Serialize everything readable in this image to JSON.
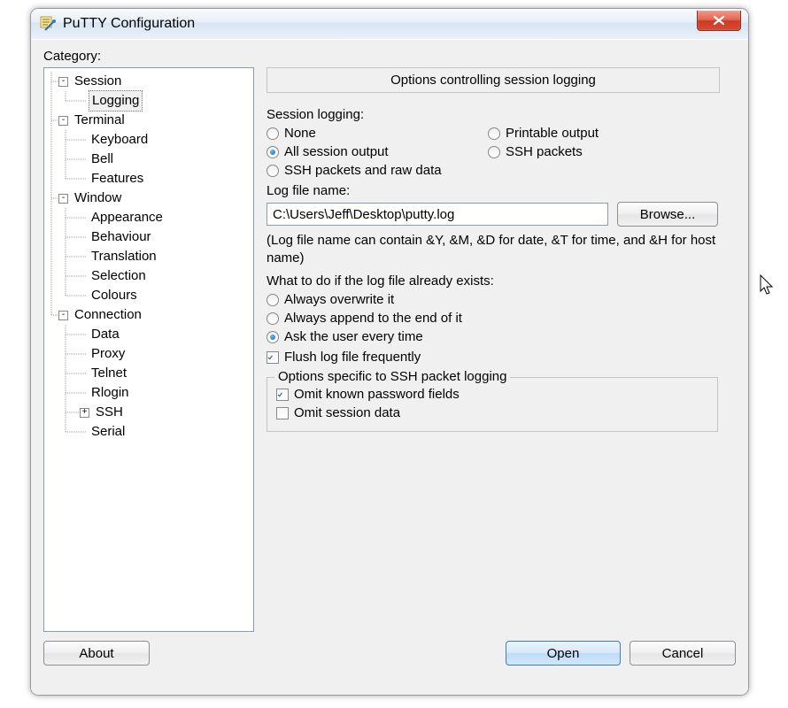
{
  "window": {
    "title": "PuTTY Configuration",
    "close_label": "X"
  },
  "sidebar": {
    "category_label": "Category:",
    "selected": "Logging",
    "tree": [
      {
        "label": "Session",
        "expand": "-",
        "children": [
          {
            "label": "Logging"
          }
        ]
      },
      {
        "label": "Terminal",
        "expand": "-",
        "children": [
          {
            "label": "Keyboard"
          },
          {
            "label": "Bell"
          },
          {
            "label": "Features"
          }
        ]
      },
      {
        "label": "Window",
        "expand": "-",
        "children": [
          {
            "label": "Appearance"
          },
          {
            "label": "Behaviour"
          },
          {
            "label": "Translation"
          },
          {
            "label": "Selection"
          },
          {
            "label": "Colours"
          }
        ]
      },
      {
        "label": "Connection",
        "expand": "-",
        "children": [
          {
            "label": "Data"
          },
          {
            "label": "Proxy"
          },
          {
            "label": "Telnet"
          },
          {
            "label": "Rlogin"
          },
          {
            "label": "SSH",
            "expand": "+"
          },
          {
            "label": "Serial"
          }
        ]
      }
    ]
  },
  "panel": {
    "heading": "Options controlling session logging",
    "session_logging_label": "Session logging:",
    "radios_logging": {
      "none": "None",
      "printable": "Printable output",
      "all": "All session output",
      "ssh": "SSH packets",
      "raw": "SSH packets and raw data",
      "selected": "all"
    },
    "logfile_label": "Log file name:",
    "logfile_value": "C:\\Users\\Jeff\\Desktop\\putty.log",
    "browse_label": "Browse...",
    "logfile_hint": "(Log file name can contain &Y, &M, &D for date, &T for time, and &H for host name)",
    "exists_label": "What to do if the log file already exists:",
    "radios_exists": {
      "overwrite": "Always overwrite it",
      "append": "Always append to the end of it",
      "ask": "Ask the user every time",
      "selected": "ask"
    },
    "flush_label": "Flush log file frequently",
    "flush_checked": true,
    "ssh_group_label": "Options specific to SSH packet logging",
    "omit_pw_label": "Omit known password fields",
    "omit_pw_checked": true,
    "omit_data_label": "Omit session data",
    "omit_data_checked": false
  },
  "buttons": {
    "about": "About",
    "open": "Open",
    "cancel": "Cancel"
  }
}
